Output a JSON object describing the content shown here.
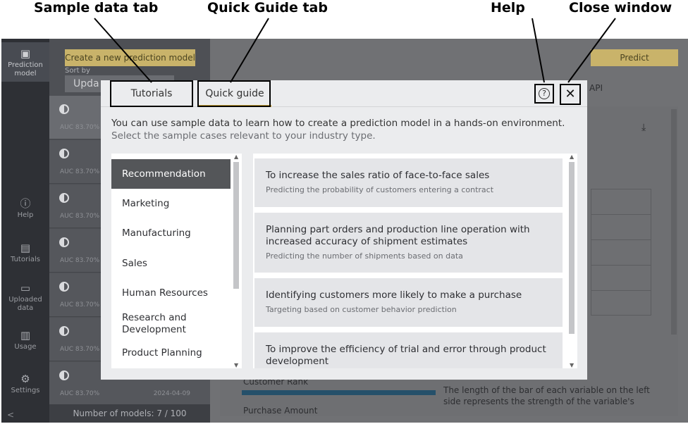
{
  "annotations": {
    "sample_tab": "Sample data tab",
    "quick_tab": "Quick Guide tab",
    "help": "Help",
    "close": "Close window"
  },
  "sidebar": {
    "items": [
      {
        "label": "Prediction model",
        "icon": "prediction-model-icon"
      },
      {
        "label": "Help",
        "icon": "help-circle-icon"
      },
      {
        "label": "Tutorials",
        "icon": "document-icon"
      },
      {
        "label": "Uploaded data",
        "icon": "folder-icon"
      },
      {
        "label": "Usage",
        "icon": "bar-chart-icon"
      },
      {
        "label": "Settings",
        "icon": "gear-icon"
      }
    ],
    "collapse": "<"
  },
  "model_list": {
    "create_button": "Create a new prediction model",
    "sort_label": "Sort by",
    "sort_value": "Upda",
    "models": [
      {
        "auc": "AUC 83.70%",
        "date": ""
      },
      {
        "auc": "AUC 83.70%",
        "date": ""
      },
      {
        "auc": "AUC 83.70%",
        "date": ""
      },
      {
        "auc": "AUC 83.70%",
        "date": ""
      },
      {
        "auc": "AUC 83.70%",
        "date": ""
      },
      {
        "auc": "AUC 83.70%",
        "date": ""
      },
      {
        "auc": "AUC 83.70%",
        "date": "2024-04-09"
      }
    ],
    "count_label": "Number of models: 7 / 100"
  },
  "main": {
    "predict_button": "Predict",
    "api_label": "API",
    "customer_rank": "Customer Rank",
    "purchase_amount": "Purchase Amount",
    "description": "The length of the bar of each variable on the left side represents the strength of the variable's"
  },
  "modal": {
    "tabs": [
      "Tutorials",
      "Quick guide"
    ],
    "help_glyph": "?",
    "close_glyph": "✕",
    "intro": "You can use sample data to learn how to create a prediction model in a hands-on environment.",
    "intro_sub": "Select the sample cases relevant to your industry type.",
    "categories": [
      "Recommendation",
      "Marketing",
      "Manufacturing",
      "Sales",
      "Human Resources",
      "Research and Development",
      "Product Planning"
    ],
    "cards": [
      {
        "title": "To increase the sales ratio of face-to-face sales",
        "desc": "Predicting the probability of customers entering a contract"
      },
      {
        "title": "Planning part orders and production line operation with increased accuracy of shipment estimates",
        "desc": "Predicting the number of shipments based on data"
      },
      {
        "title": "Identifying customers more likely to make a purchase",
        "desc": "Targeting based on customer behavior prediction"
      },
      {
        "title": "To improve the efficiency of trial and error through product development",
        "desc": ""
      }
    ]
  },
  "colors": {
    "accent": "#c9b36a",
    "sidebar": "#2e3035",
    "active_category": "#545659",
    "tab_underline": "#c9a43a"
  }
}
